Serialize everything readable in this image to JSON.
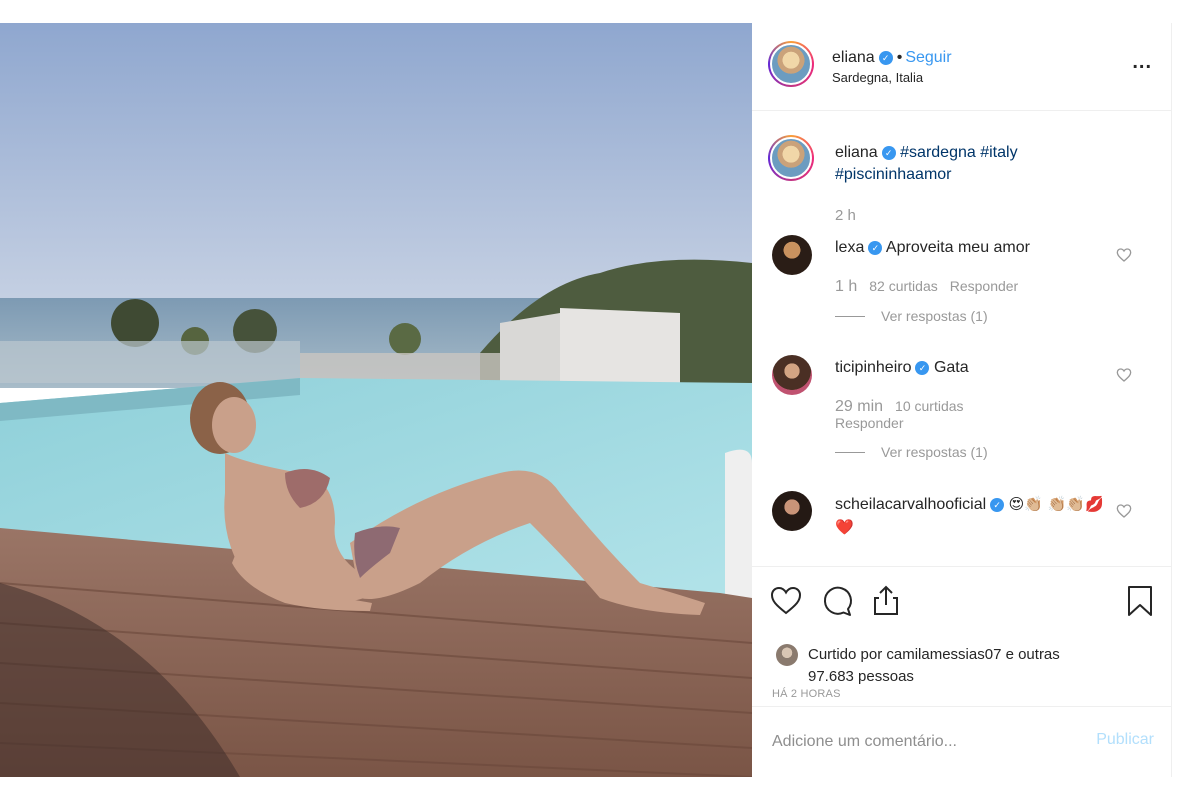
{
  "post": {
    "username": "eliana",
    "follow_label": "Seguir",
    "separator": "•",
    "location": "Sardegna, Italia",
    "more_label": "..."
  },
  "caption": {
    "username": "eliana",
    "text": "#sardegna #italy #piscininhaamor",
    "time": "2 h"
  },
  "comments": [
    {
      "username": "lexa",
      "text": "Aproveita meu amor",
      "time": "1 h",
      "likes": "82 curtidas",
      "reply_label": "Responder",
      "view_replies": "Ver respostas (1)"
    },
    {
      "username": "ticipinheiro",
      "text": "Gata",
      "time": "29 min",
      "likes": "10 curtidas",
      "reply_label": "Responder",
      "view_replies": "Ver respostas (1)"
    },
    {
      "username": "scheilacarvalhooficial",
      "text": "😍👏🏼 👏🏼👏🏼💋❤️"
    }
  ],
  "likes": {
    "text": "Curtido por camilamessias07 e outras 97.683 pessoas"
  },
  "post_time": "HÁ 2 HORAS",
  "comment_box": {
    "placeholder": "Adicione um comentário...",
    "publish_label": "Publicar"
  },
  "colors": {
    "link": "#3897f0",
    "hashtag": "#003569",
    "muted": "#999999",
    "publish_disabled": "#b2dffc"
  },
  "icons": {
    "like": "heart-icon",
    "comment": "comment-icon",
    "share": "share-icon",
    "save": "bookmark-icon"
  }
}
